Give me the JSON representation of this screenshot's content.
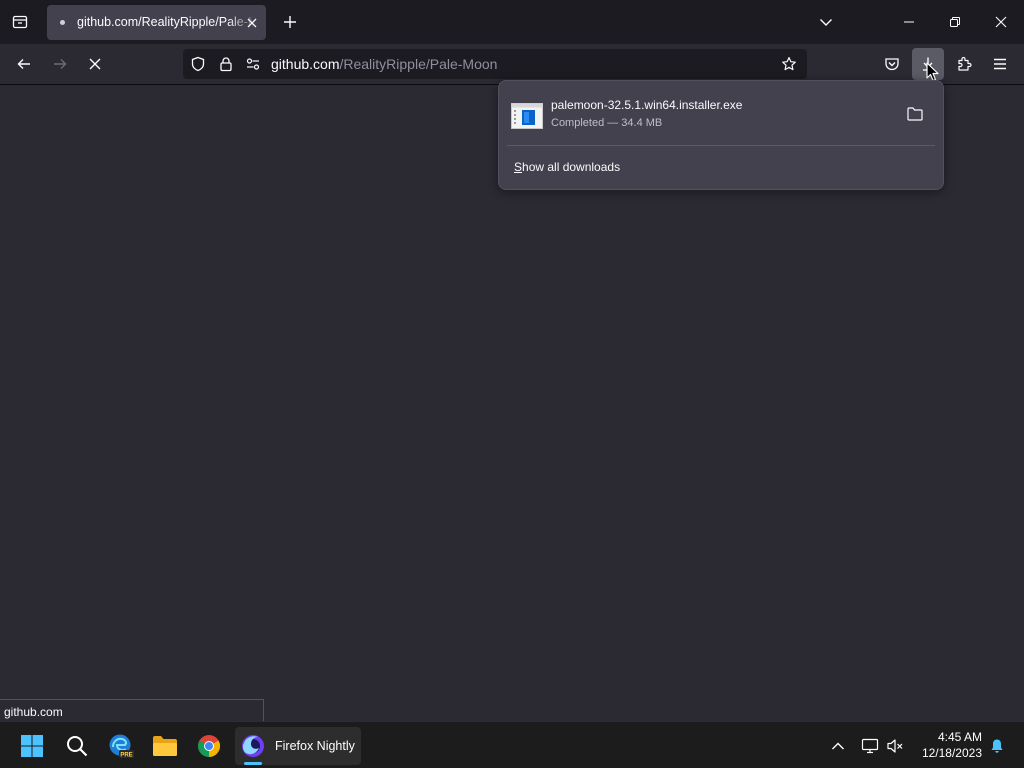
{
  "tab": {
    "title": "github.com/RealityRipple/Pale-Moon"
  },
  "urlbar": {
    "host": "github.com",
    "path": "/RealityRipple/Pale-Moon"
  },
  "downloads_panel": {
    "items": [
      {
        "filename": "palemoon-32.5.1.win64.installer.exe",
        "status": "Completed — 34.4 MB"
      }
    ],
    "show_all_accesskey": "S",
    "show_all_rest": "how all downloads"
  },
  "status_bar": {
    "text": "github.com"
  },
  "taskbar": {
    "active_app_label": "Firefox Nightly",
    "time": "4:45 AM",
    "date": "12/18/2023"
  },
  "colors": {
    "toolbar": "#2b2a33",
    "tabstrip": "#1c1b22",
    "selected_tab": "#42414d",
    "windows_accent": "#4cc2ff"
  }
}
